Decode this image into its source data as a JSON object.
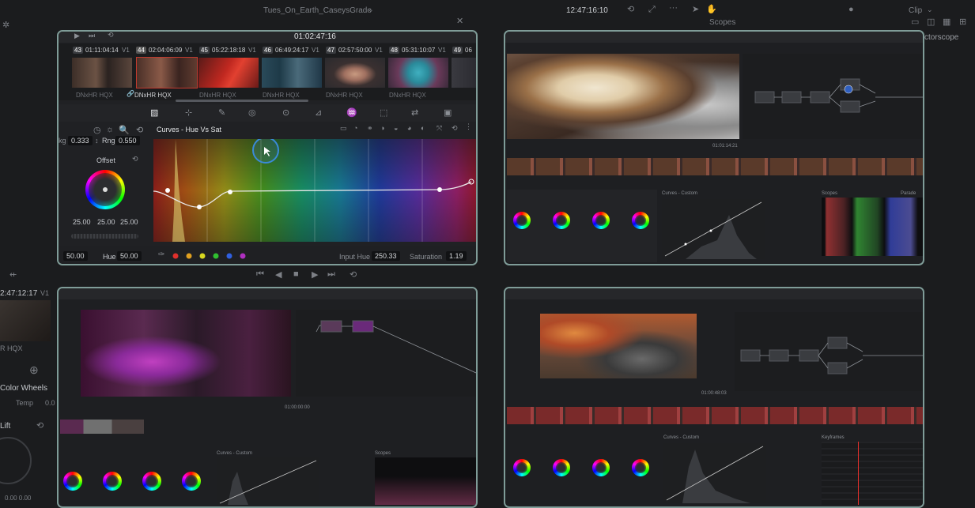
{
  "topbar": {
    "project_title": "Tues_On_Earth_CaseysGrade",
    "timecode": "12:47:16:10",
    "scopes_label": "Scopes",
    "clip_label": "Clip",
    "vectorscope_label": "ctorscope"
  },
  "left_edge": {
    "timecode": "2:47:12:17",
    "track": "V1",
    "codec": "R HQX",
    "color_wheels_label": "Color Wheels",
    "temp_label": "Temp",
    "temp_value": "0.0",
    "lift_label": "Lift",
    "lift_values": "0.00  0.00"
  },
  "main_panel": {
    "timecode": "01:02:47:16",
    "clips": [
      {
        "num": "43",
        "tc": "01:11:04:14",
        "track": "V1",
        "codec": "DNxHR HQX"
      },
      {
        "num": "44",
        "tc": "02:04:06:09",
        "track": "V1",
        "codec": "DNxHR HQX"
      },
      {
        "num": "45",
        "tc": "05:22:18:18",
        "track": "V1",
        "codec": "DNxHR HQX"
      },
      {
        "num": "46",
        "tc": "06:49:24:17",
        "track": "V1",
        "codec": "DNxHR HQX"
      },
      {
        "num": "47",
        "tc": "02:57:50:00",
        "track": "V1",
        "codec": "DNxHR HQX"
      },
      {
        "num": "48",
        "tc": "05:31:10:07",
        "track": "V1",
        "codec": "DNxHR HQX"
      },
      {
        "num": "49",
        "tc": "06",
        "track": "",
        "codec": ""
      }
    ],
    "curves_title": "Curves - Hue Vs Sat",
    "left_value": "0.333",
    "rng_label": "Rng",
    "rng_value": "0.550",
    "offset_label": "Offset",
    "offset_values": [
      "25.00",
      "25.00",
      "25.00"
    ],
    "bottom_left_value": "50.00",
    "hue_label": "Hue",
    "hue_value": "50.00",
    "input_hue_label": "Input Hue",
    "input_hue_value": "250.33",
    "saturation_label": "Saturation",
    "saturation_value": "1.19"
  },
  "top_right_panel": {
    "timecode": "01:01:14:21",
    "curves_label": "Curves - Custom",
    "scopes_label": "Scopes",
    "parade_label": "Parade"
  },
  "bottom_left_panel": {
    "timecode": "01:00:00:00",
    "scopes_label": "Scopes",
    "curves_label": "Curves - Custom"
  },
  "bottom_right_panel": {
    "timecode": "01:00:48:03",
    "curves_label": "Curves - Custom",
    "keyframes_label": "Keyframes"
  },
  "colors": {
    "panel_border": "#7f9c98",
    "accent_red": "#e0302c"
  }
}
